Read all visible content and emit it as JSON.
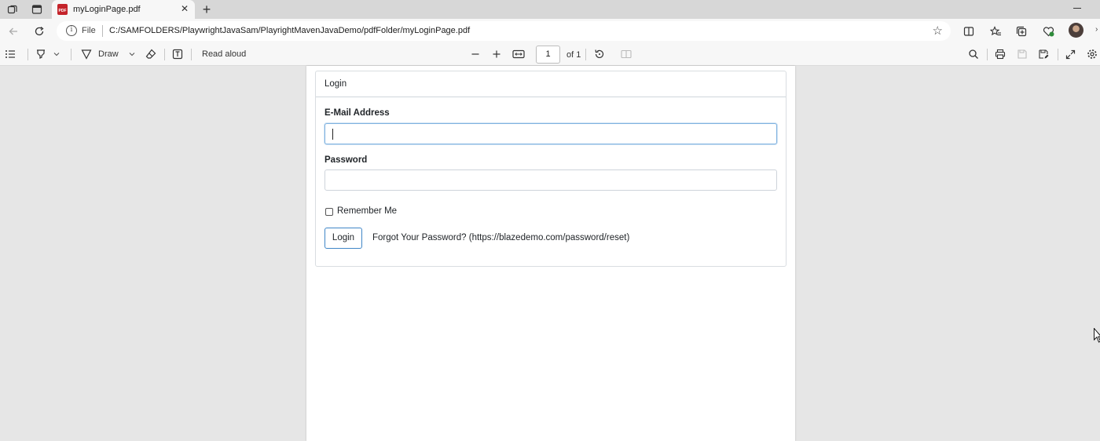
{
  "browser": {
    "tab_title": "myLoginPage.pdf",
    "tab_close": "✕",
    "new_tab": "+",
    "address_scheme": "File",
    "address_url": "C:/SAMFOLDERS/PlaywrightJavaSam/PlayrightMavenJavaDemo/pdfFolder/myLoginPage.pdf"
  },
  "pdf_toolbar": {
    "draw_label": "Draw",
    "read_aloud_label": "Read aloud",
    "page_number": "1",
    "page_count": "of 1"
  },
  "login_form": {
    "header": "Login",
    "email_label": "E-Mail Address",
    "email_value": "",
    "password_label": "Password",
    "password_value": "",
    "remember_label": "Remember Me",
    "remember_checked": false,
    "login_button": "Login",
    "forgot_text": "Forgot Your Password? (https://blazedemo.com/password/reset)"
  },
  "colors": {
    "tab_strip": "#d7d7d7",
    "toolbar": "#f7f7f7",
    "viewer_background": "#e6e6e6",
    "focus_border": "#7fb2e0",
    "button_border": "#3f86c7"
  }
}
